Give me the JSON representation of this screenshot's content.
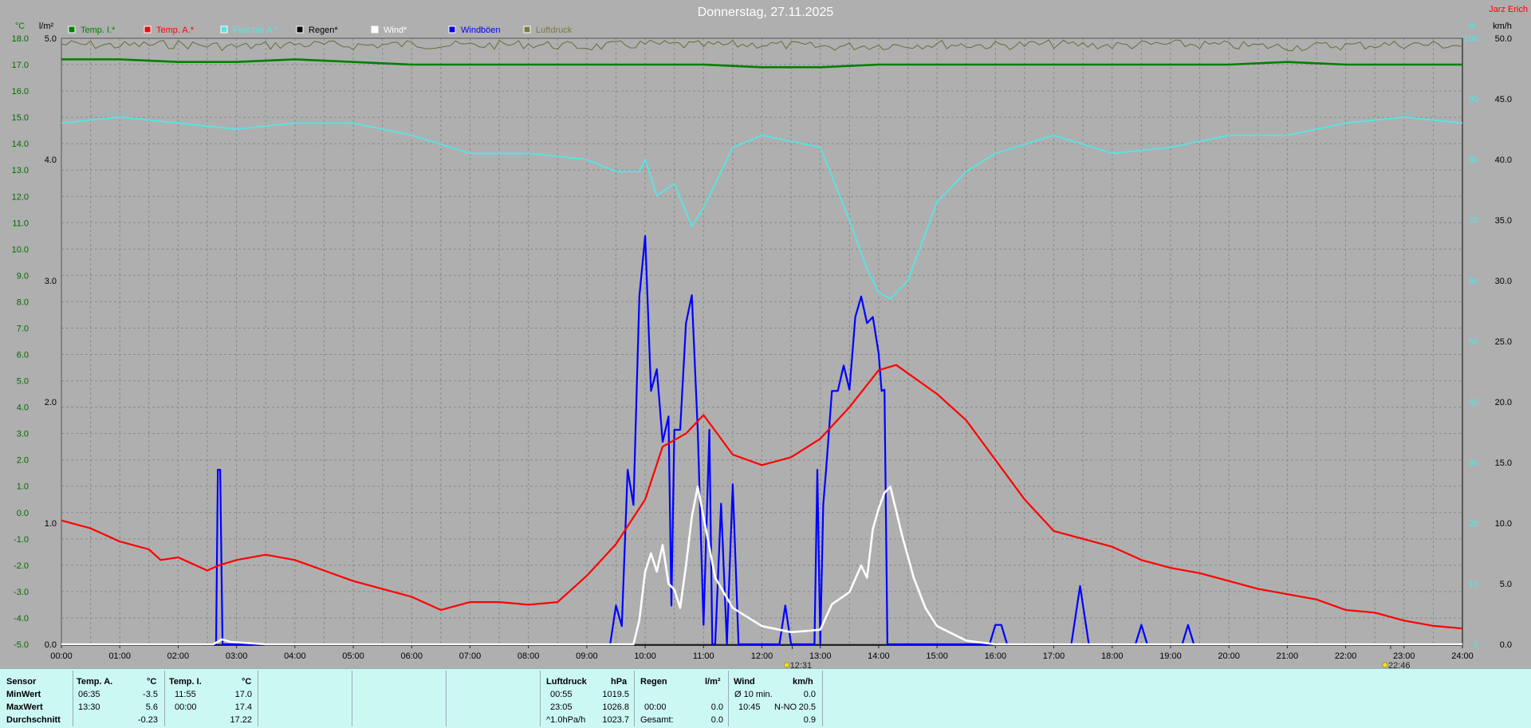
{
  "title": "Donnerstag, 27.11.2025",
  "author": "Jarz Erich",
  "axis_units": {
    "left_temp": "°C",
    "left_rain": "l/m²",
    "right_hum": "%",
    "right_wind": "km/h"
  },
  "colors": {
    "background": "#afafaf",
    "grid": "#8a8a8a",
    "temp_in": "#008000",
    "temp_out": "#ff0000",
    "humidity": "#55e6e6",
    "rain": "#000000",
    "wind": "#ffffff",
    "gust": "#0000ff",
    "pressure": "#6b6b3a",
    "panel": "#ccf8f4"
  },
  "legend": [
    {
      "label": "Temp. I.*",
      "color": "#008000"
    },
    {
      "label": "Temp. A.*",
      "color": "#ff0000"
    },
    {
      "label": "Feuchte A.*",
      "color": "#55e6e6"
    },
    {
      "label": "Regen*",
      "color": "#000000"
    },
    {
      "label": "Wind*",
      "color": "#ffffff"
    },
    {
      "label": "Windböen",
      "color": "#0000ff"
    },
    {
      "label": "Luftdruck",
      "color": "#7a7a45"
    }
  ],
  "markers": [
    {
      "label": "12:31",
      "x": 12.52
    },
    {
      "label": "22:46",
      "x": 22.77
    }
  ],
  "chart_data": {
    "type": "line",
    "title": "Donnerstag, 27.11.2025",
    "x_ticks": [
      "00:00",
      "01:00",
      "02:00",
      "03:00",
      "04:00",
      "05:00",
      "06:00",
      "07:00",
      "08:00",
      "09:00",
      "10:00",
      "11:00",
      "12:00",
      "13:00",
      "14:00",
      "15:00",
      "16:00",
      "17:00",
      "18:00",
      "19:00",
      "20:00",
      "21:00",
      "22:00",
      "23:00",
      "24:00"
    ],
    "xlim": [
      0,
      24
    ],
    "temp_axis": {
      "unit": "°C",
      "ylim": [
        -5.0,
        18.0
      ],
      "ticks": [
        "18.0",
        "17.0",
        "16.0",
        "15.0",
        "14.0",
        "13.0",
        "12.0",
        "11.0",
        "10.0",
        "9.0",
        "8.0",
        "7.0",
        "6.0",
        "5.0",
        "4.0",
        "3.0",
        "2.0",
        "1.0",
        "0.0",
        "-1.0",
        "-2.0",
        "-3.0",
        "-4.0",
        "-5.0"
      ]
    },
    "rain_axis": {
      "unit": "l/m²",
      "ylim": [
        0.0,
        5.0
      ],
      "ticks": [
        "5.0",
        "4.0",
        "3.0",
        "2.0",
        "1.0",
        "0.0"
      ]
    },
    "humidity_axis": {
      "unit": "%",
      "ylim": [
        0,
        100
      ],
      "ticks": [
        "100",
        "90",
        "80",
        "70",
        "60",
        "50",
        "40",
        "30",
        "20",
        "10",
        "0"
      ]
    },
    "wind_axis": {
      "unit": "km/h",
      "ylim": [
        0.0,
        50.0
      ],
      "ticks": [
        "50.0",
        "45.0",
        "40.0",
        "35.0",
        "30.0",
        "25.0",
        "20.0",
        "15.0",
        "10.0",
        "5.0",
        "0.0"
      ]
    },
    "series": [
      {
        "name": "Temp. I.*",
        "axis": "temp",
        "x": [
          0,
          1,
          2,
          3,
          4,
          5,
          6,
          7,
          8,
          9,
          10,
          11,
          12,
          12.5,
          13,
          14,
          15,
          16,
          17,
          18,
          19,
          20,
          21,
          22,
          23,
          24
        ],
        "y": [
          17.2,
          17.2,
          17.1,
          17.1,
          17.2,
          17.1,
          17.0,
          17.0,
          17.0,
          17.0,
          17.0,
          17.0,
          16.9,
          16.9,
          16.9,
          17.0,
          17.0,
          17.0,
          17.0,
          17.0,
          17.0,
          17.0,
          17.1,
          17.0,
          17.0,
          17.0
        ]
      },
      {
        "name": "Temp. A.*",
        "axis": "temp",
        "x": [
          0,
          0.5,
          1,
          1.5,
          1.7,
          2,
          2.5,
          2.7,
          3,
          3.5,
          4,
          4.5,
          5,
          5.5,
          6,
          6.5,
          7,
          7.5,
          8,
          8.5,
          9,
          9.5,
          10,
          10.3,
          10.7,
          11,
          11.5,
          12,
          12.5,
          13,
          13.5,
          14,
          14.3,
          15,
          15.5,
          16,
          16.5,
          17,
          17.5,
          18,
          18.5,
          19,
          19.5,
          20,
          20.5,
          21,
          21.5,
          22,
          22.5,
          23,
          23.5,
          24
        ],
        "y": [
          -0.3,
          -0.6,
          -1.1,
          -1.4,
          -1.8,
          -1.7,
          -2.2,
          -2.0,
          -1.8,
          -1.6,
          -1.8,
          -2.2,
          -2.6,
          -2.9,
          -3.2,
          -3.7,
          -3.4,
          -3.4,
          -3.5,
          -3.4,
          -2.4,
          -1.2,
          0.5,
          2.5,
          3.0,
          3.7,
          2.2,
          1.8,
          2.1,
          2.8,
          4.0,
          5.4,
          5.6,
          4.5,
          3.5,
          2.0,
          0.5,
          -0.7,
          -1.0,
          -1.3,
          -1.8,
          -2.1,
          -2.3,
          -2.6,
          -2.9,
          -3.1,
          -3.3,
          -3.7,
          -3.8,
          -4.1,
          -4.3,
          -4.4
        ]
      },
      {
        "name": "Feuchte A.*",
        "axis": "humidity",
        "x": [
          0,
          1,
          2,
          3,
          4,
          5,
          6,
          7,
          8,
          9,
          9.5,
          9.9,
          10,
          10.2,
          10.5,
          10.8,
          11,
          11.5,
          12,
          12.5,
          13,
          13.5,
          13.8,
          14,
          14.2,
          14.5,
          15,
          15.5,
          16,
          17,
          18,
          19,
          20,
          21,
          22,
          23,
          24
        ],
        "y": [
          86,
          87,
          86,
          85,
          86,
          86,
          84,
          81,
          81,
          80,
          78,
          78,
          80,
          74,
          76,
          69,
          72,
          82,
          84,
          83,
          82,
          70,
          62,
          58,
          57,
          60,
          73,
          78,
          81,
          84,
          81,
          82,
          84,
          84,
          86,
          87,
          86
        ]
      },
      {
        "name": "Windböen",
        "axis": "wind",
        "x": [
          0,
          2.65,
          2.68,
          2.72,
          2.76,
          2.8,
          9.4,
          9.5,
          9.6,
          9.7,
          9.8,
          9.9,
          10,
          10.1,
          10.2,
          10.3,
          10.4,
          10.45,
          10.5,
          10.6,
          10.7,
          10.8,
          10.9,
          11,
          11.1,
          11.15,
          11.2,
          11.3,
          11.4,
          11.5,
          11.6,
          11.7,
          11.8,
          12.3,
          12.4,
          12.5,
          12.9,
          12.95,
          13.0,
          13.05,
          13.1,
          13.2,
          13.3,
          13.4,
          13.5,
          13.6,
          13.7,
          13.8,
          13.9,
          14.0,
          14.05,
          14.1,
          14.15,
          14.2,
          14.3,
          14.4,
          14.5,
          14.6,
          14.65,
          15.0,
          15.9,
          16.0,
          16.1,
          16.2,
          17.3,
          17.45,
          17.6,
          17.8,
          18.4,
          18.5,
          18.6,
          19.2,
          19.3,
          19.4,
          24
        ],
        "y": [
          0,
          0,
          14.4,
          14.4,
          0,
          0,
          0,
          3.2,
          1.5,
          14.4,
          11.5,
          28.7,
          33.7,
          20.9,
          22.7,
          16.7,
          18.8,
          3.2,
          17.7,
          17.7,
          26.5,
          28.8,
          17.7,
          1.6,
          17.7,
          0,
          0,
          11.6,
          0,
          13.2,
          0,
          0,
          0,
          0,
          3.2,
          0,
          0,
          14.4,
          0,
          11.5,
          14.4,
          20.9,
          20.9,
          23.0,
          21.0,
          27.0,
          28.7,
          26.5,
          27.0,
          24.0,
          20.9,
          21.0,
          0,
          0,
          0,
          0,
          0,
          0,
          0,
          0,
          0,
          1.6,
          1.6,
          0,
          0,
          4.8,
          0,
          0,
          0,
          1.6,
          0,
          0,
          1.6,
          0,
          0
        ]
      },
      {
        "name": "Wind*",
        "axis": "wind",
        "x": [
          0,
          2.6,
          2.75,
          2.9,
          3.5,
          9.8,
          9.9,
          10,
          10.1,
          10.2,
          10.3,
          10.4,
          10.5,
          10.6,
          10.7,
          10.8,
          10.9,
          11,
          11.2,
          11.5,
          12,
          12.5,
          13.0,
          13.2,
          13.5,
          13.7,
          13.8,
          13.9,
          14.0,
          14.1,
          14.2,
          14.3,
          14.4,
          14.6,
          14.8,
          15,
          15.5,
          16,
          24
        ],
        "y": [
          0,
          0,
          0.4,
          0.2,
          0,
          0,
          2.0,
          6.0,
          7.5,
          6.0,
          8.2,
          5.0,
          4.5,
          3.0,
          6.5,
          10.5,
          13.0,
          10.5,
          5.5,
          3.0,
          1.5,
          1.0,
          1.2,
          3.3,
          4.3,
          6.5,
          5.5,
          9.5,
          11.2,
          12.5,
          13.0,
          11.0,
          9.0,
          5.5,
          3.0,
          1.5,
          0.3,
          0,
          0
        ]
      },
      {
        "name": "Regen*",
        "axis": "rain",
        "x": [
          0,
          24
        ],
        "y": [
          0,
          0
        ]
      },
      {
        "name": "Luftdruck",
        "axis": "temp",
        "note": "noisy line near top edge",
        "x": [
          0,
          1,
          2,
          3,
          4,
          5,
          6,
          7,
          8,
          9,
          10,
          11,
          12,
          13,
          14,
          15,
          16,
          17,
          18,
          19,
          20,
          21,
          22,
          23,
          24
        ],
        "y": [
          17.95,
          17.9,
          17.95,
          17.85,
          17.95,
          17.9,
          17.95,
          17.9,
          17.95,
          17.85,
          17.95,
          17.9,
          17.95,
          17.85,
          17.9,
          17.95,
          17.9,
          17.95,
          17.9,
          17.95,
          17.9,
          17.85,
          17.9,
          17.95,
          17.9
        ]
      }
    ]
  },
  "stats": {
    "row_labels": [
      "Sensor",
      "MinWert",
      "MaxWert",
      "Durchschnitt"
    ],
    "temp_a": {
      "header": "Temp. A.",
      "unit": "°C",
      "min_time": "06:35",
      "min": "-3.5",
      "max_time": "13:30",
      "max": "5.6",
      "avg": "-0.23"
    },
    "temp_i": {
      "header": "Temp. I.",
      "unit": "°C",
      "min_time": "11:55",
      "min": "17.0",
      "max_time": "00:00",
      "max": "17.4",
      "avg": "17.22"
    },
    "pressure": {
      "header": "Luftdruck",
      "unit": "hPa",
      "min_time": "00:55",
      "min": "1019.5",
      "max_time": "23:05",
      "max": "1026.8",
      "trend_label": "^1.0hPa/h",
      "current": "1023.7"
    },
    "rain": {
      "header": "Regen",
      "unit": "l/m²",
      "max_time": "00:00",
      "max": "0.0",
      "total_label": "Gesamt:",
      "total": "0.0"
    },
    "wind": {
      "header": "Wind",
      "unit": "km/h",
      "avg_label": "Ø 10 min.",
      "avg": "0.0",
      "max_time": "10:45",
      "max_dir": "N-NO",
      "max": "20.5",
      "day_avg": "0.9"
    }
  }
}
